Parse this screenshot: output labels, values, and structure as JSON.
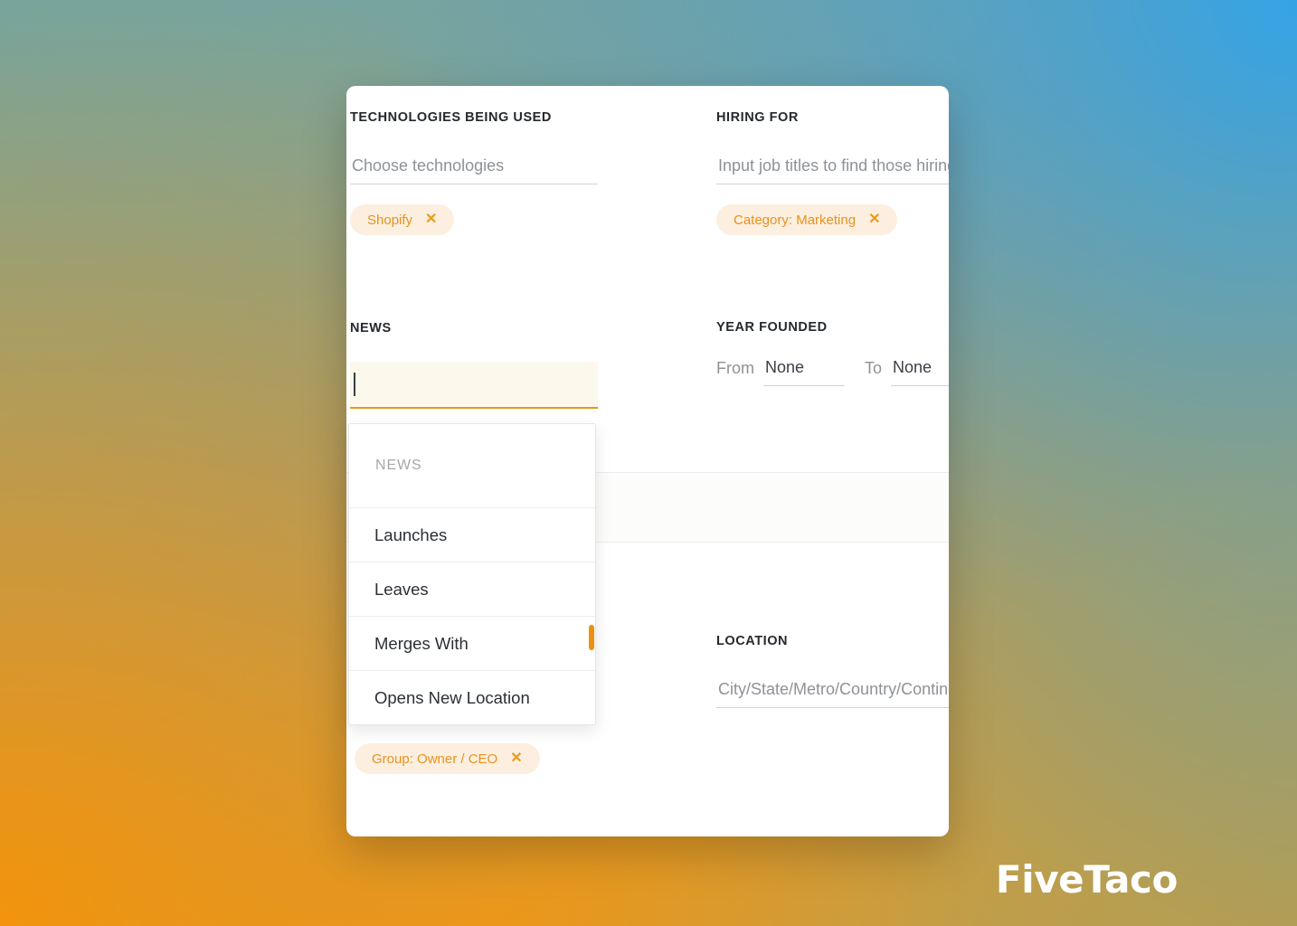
{
  "brand": {
    "logo_text": "FiveTaco",
    "accent_color": "#e8921e",
    "chip_bg": "#fcefdf",
    "focus_bg": "#fdf8ec",
    "focus_underline": "#e8961e"
  },
  "background": {
    "top_left_color": "#6fa5a6",
    "top_right_color": "#34a4e6",
    "bottom_left_color": "#f2940d",
    "bottom_right_color": "#b29d55"
  },
  "card": {
    "technologies": {
      "label": "TECHNOLOGIES BEING USED",
      "placeholder": "Choose technologies",
      "value": "",
      "chips": [
        {
          "label": "Shopify",
          "remove_icon": "✕"
        }
      ]
    },
    "hiring": {
      "label": "HIRING FOR",
      "placeholder": "Input job titles to find those hiring",
      "value": "",
      "chips": [
        {
          "label": "Category: Marketing",
          "remove_icon": "✕"
        }
      ]
    },
    "news": {
      "label": "NEWS",
      "placeholder": "",
      "value": "",
      "dropdown": {
        "group_header": "NEWS",
        "options": [
          "Launches",
          "Leaves",
          "Merges With",
          "Opens New Location"
        ],
        "scrollbar_color": "#ef8f12"
      }
    },
    "year_founded": {
      "label": "YEAR FOUNDED",
      "from_label": "From",
      "from_value": "None",
      "to_label": "To",
      "to_value": "None"
    },
    "location": {
      "label": "LOCATION",
      "placeholder": "City/State/Metro/Country/Continent",
      "value": ""
    },
    "group": {
      "chips": [
        {
          "label": "Group: Owner / CEO",
          "remove_icon": "✕"
        }
      ]
    }
  }
}
